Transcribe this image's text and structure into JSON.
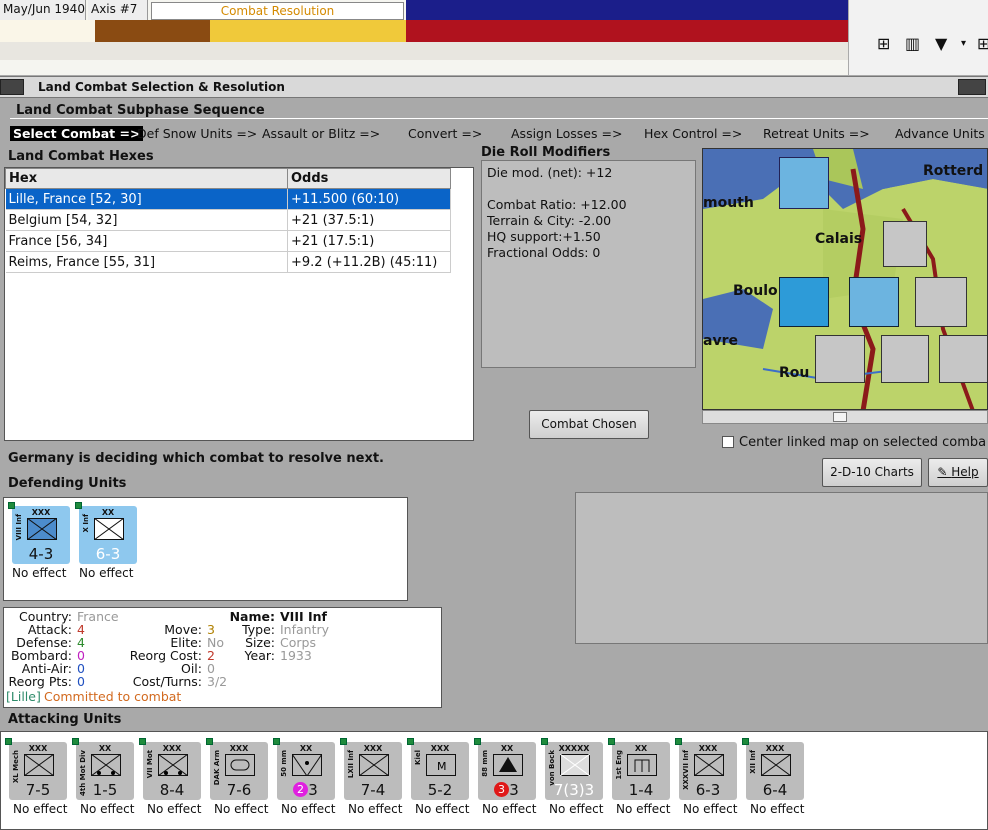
{
  "top": {
    "date": "May/Jun 1940",
    "turn": "Axis #7",
    "phase": "Combat Resolution"
  },
  "window": {
    "title": "Land Combat Selection & Resolution"
  },
  "sequence": {
    "header": "Land Combat Subphase Sequence",
    "steps": [
      "Select Combat =>",
      "Def Snow Units =>",
      "Assault or Blitz =>",
      "Convert =>",
      "Assign Losses =>",
      "Hex Control =>",
      "Retreat Units =>",
      "Advance Units"
    ]
  },
  "hexes": {
    "header": "Land Combat Hexes",
    "col_hex": "Hex",
    "col_odds": "Odds",
    "rows": [
      {
        "hex": "Lille, France [52, 30]",
        "odds": "+11.500 (60:10)"
      },
      {
        "hex": "Belgium [54, 32]",
        "odds": "+21 (37.5:1)"
      },
      {
        "hex": "France [56, 34]",
        "odds": "+21 (17.5:1)"
      },
      {
        "hex": "Reims, France [55, 31]",
        "odds": "+9.2 (+11.2B) (45:11)"
      }
    ]
  },
  "drm": {
    "header": "Die Roll Modifiers",
    "net": "Die mod. (net): +12",
    "ratio": "Combat Ratio: +12.00",
    "terrain": "Terrain & City: -2.00",
    "hq": "HQ support:+1.50",
    "fractional": "Fractional Odds: 0"
  },
  "buttons": {
    "combat_chosen": "Combat Chosen",
    "charts": "2-D-10 Charts",
    "help": "Help"
  },
  "map": {
    "labels": [
      "Rotterd",
      "Calais",
      "Boulo",
      "mouth",
      "avre",
      "Rou"
    ],
    "checkbox_label": "Center linked map on selected comba"
  },
  "status": "Germany is deciding which combat to resolve next.",
  "defending": {
    "header": "Defending Units",
    "units": [
      {
        "size": "XXX",
        "name": "VIII Inf",
        "value": "4-3",
        "effect": "No effect"
      },
      {
        "size": "XX",
        "name": "X Inf",
        "value": "6-3",
        "effect": "No effect"
      }
    ]
  },
  "info": {
    "country_label": "Country:",
    "country": "France",
    "attack_label": "Attack:",
    "attack": "4",
    "defense_label": "Defense:",
    "defense": "4",
    "bombard_label": "Bombard:",
    "bombard": "0",
    "antiair_label": "Anti-Air:",
    "antiair": "0",
    "reorg_label": "Reorg Pts:",
    "reorg": "0",
    "move_label": "Move:",
    "move": "3",
    "elite_label": "Elite:",
    "elite": "No",
    "reorgcost_label": "Reorg Cost:",
    "reorgcost": "2",
    "oil_label": "Oil:",
    "oil": "0",
    "costturns_label": "Cost/Turns:",
    "costturns": "3/2",
    "name_label": "Name:",
    "name": "VIII Inf",
    "type_label": "Type:",
    "type": "Infantry",
    "size_label": "Size:",
    "size": "Corps",
    "year_label": "Year:",
    "year": "1933",
    "location": "[Lille]",
    "committed": "Committed to combat"
  },
  "attacking": {
    "header": "Attacking Units",
    "units": [
      {
        "size": "XXX",
        "name": "XL Mech",
        "value": "7-5",
        "effect": "No effect"
      },
      {
        "size": "XX",
        "name": "4th Mot Div",
        "value": "1-5",
        "effect": "No effect"
      },
      {
        "size": "XXX",
        "name": "VII Mot",
        "value": "8-4",
        "effect": "No effect"
      },
      {
        "size": "XXX",
        "name": "DAK Arm",
        "value": "7-6",
        "effect": "No effect"
      },
      {
        "size": "XX",
        "name": "50 mm",
        "value": "3",
        "badge": "2",
        "effect": "No effect"
      },
      {
        "size": "XXX",
        "name": "LXII Inf",
        "value": "7-4",
        "effect": "No effect"
      },
      {
        "size": "XXX",
        "name": "Kiel",
        "value": "5-2",
        "effect": "No effect"
      },
      {
        "size": "XX",
        "name": "88 mm",
        "value": "3",
        "badge": "3",
        "effect": "No effect"
      },
      {
        "size": "XXXXX",
        "name": "von Bock",
        "value": "7(3)3",
        "effect": "No effect"
      },
      {
        "size": "XX",
        "name": "1st Eng",
        "value": "1-4",
        "effect": "No effect"
      },
      {
        "size": "XXX",
        "name": "XXXVII Inf",
        "value": "6-3",
        "effect": "No effect"
      },
      {
        "size": "XXX",
        "name": "XII Inf",
        "value": "6-4",
        "effect": "No effect"
      }
    ]
  },
  "colors": {
    "selected_row": "#0a64c8",
    "counter_blue": "#8ec8ee",
    "counter_gray": "#bcbcbc"
  }
}
